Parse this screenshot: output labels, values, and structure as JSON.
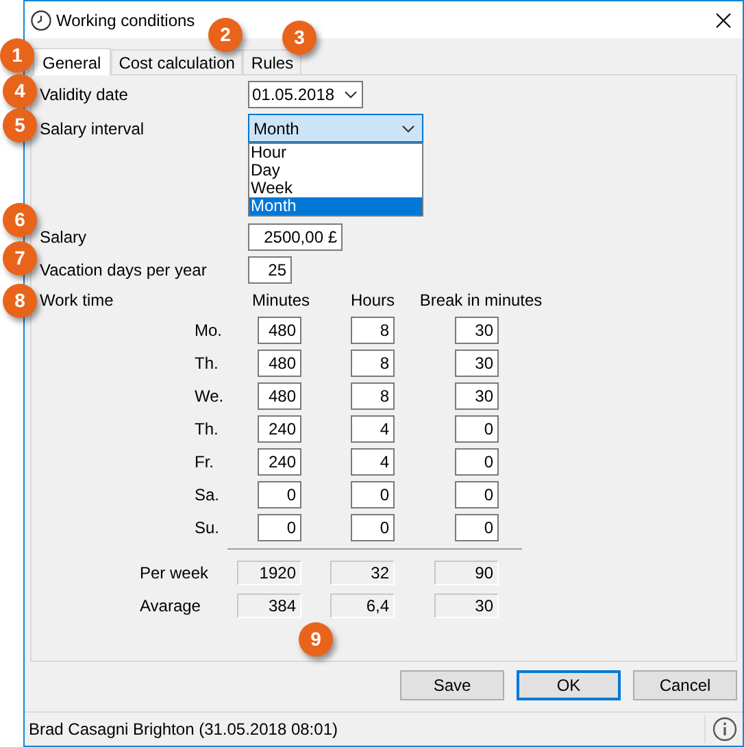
{
  "window": {
    "title": "Working conditions"
  },
  "tabs": [
    {
      "label": "General",
      "selected": true
    },
    {
      "label": "Cost calculation",
      "selected": false
    },
    {
      "label": "Rules",
      "selected": false
    }
  ],
  "validity_date": {
    "label": "Validity date",
    "value": "01.05.2018"
  },
  "salary_interval": {
    "label": "Salary interval",
    "value": "Month",
    "expanded": true,
    "options": [
      {
        "label": "Hour",
        "selected": false
      },
      {
        "label": "Day",
        "selected": false
      },
      {
        "label": "Week",
        "selected": false
      },
      {
        "label": "Month",
        "selected": true
      }
    ]
  },
  "salary": {
    "label": "Salary",
    "value": "2500,00 £"
  },
  "vacation_days": {
    "label": "Vacation days per year",
    "value": "25"
  },
  "work_time": {
    "label": "Work time",
    "columns": [
      "Minutes",
      "Hours",
      "Break in minutes"
    ],
    "rows": [
      {
        "day": "Mo.",
        "values": [
          "480",
          "8",
          "30"
        ]
      },
      {
        "day": "Th.",
        "values": [
          "480",
          "8",
          "30"
        ]
      },
      {
        "day": "We.",
        "values": [
          "480",
          "8",
          "30"
        ]
      },
      {
        "day": "Th.",
        "values": [
          "240",
          "4",
          "0"
        ]
      },
      {
        "day": "Fr.",
        "values": [
          "240",
          "4",
          "0"
        ]
      },
      {
        "day": "Sa.",
        "values": [
          "0",
          "0",
          "0"
        ]
      },
      {
        "day": "Su.",
        "values": [
          "0",
          "0",
          "0"
        ]
      }
    ],
    "totals": [
      {
        "label": "Per week",
        "values": [
          "1920",
          "32",
          "90"
        ]
      },
      {
        "label": "Avarage",
        "values": [
          "384",
          "6,4",
          "30"
        ]
      }
    ]
  },
  "buttons": [
    {
      "label": "Save",
      "default": false
    },
    {
      "label": "OK",
      "default": true
    },
    {
      "label": "Cancel",
      "default": false
    }
  ],
  "status_bar": {
    "text": "Brad Casagni Brighton (31.05.2018 08:01)"
  },
  "callouts": [
    "1",
    "2",
    "3",
    "4",
    "5",
    "6",
    "7",
    "8",
    "9"
  ]
}
